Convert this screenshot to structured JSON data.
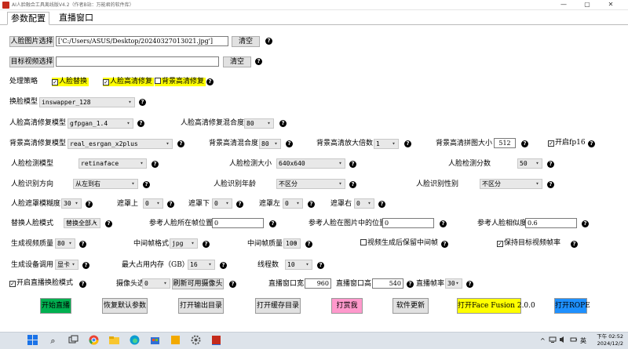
{
  "window": {
    "title": "AI人脸融合工具离线版V4.2（作者B站：万能君的软件库）",
    "minimize_glyph": "—",
    "maximize_glyph": "▢",
    "close_glyph": "✕"
  },
  "tabs": [
    "参数配置",
    "直播窗口"
  ],
  "help_glyph": "?",
  "dropdown_arrow": "▾",
  "check_glyph": "✓",
  "face_image": {
    "button": "人脸图片选择",
    "value": "['C:/Users/ASUS/Desktop/20240327013021.jpg']",
    "clear": "清空"
  },
  "target_video": {
    "button": "目标视频选择",
    "value": "",
    "clear": "清空"
  },
  "strategy": {
    "label": "处理策略",
    "options": [
      {
        "label": "人脸替换",
        "checked": true,
        "highlight": "#ffff00"
      },
      {
        "label": "人脸高清修复",
        "checked": true,
        "highlight": "#ffff00"
      },
      {
        "label": "背景高清修复",
        "checked": false,
        "highlight": "#ffff00"
      }
    ]
  },
  "swap_model": {
    "label": "换脸模型",
    "value": "inswapper_128"
  },
  "face_enhance": {
    "model_label": "人脸高清修复模型",
    "model_value": "gfpgan_1.4",
    "blend_label": "人脸高清修复混合度",
    "blend_value": "80"
  },
  "bg_enhance": {
    "model_label": "背景高清修复模型",
    "model_value": "real_esrgan_x2plus",
    "blend_label": "背景高清混合度",
    "blend_value": "80",
    "scale_label": "背景高清放大倍数",
    "scale_value": "1",
    "tile_label": "背景高清拼图大小",
    "tile_value": "512",
    "fp16_label": "开启fp16",
    "fp16_checked": true
  },
  "detect": {
    "model_label": "人脸检测模型",
    "model_value": "retinaface",
    "size_label": "人脸检测大小",
    "size_value": "640x640",
    "score_label": "人脸检测分数",
    "score_value": "50"
  },
  "recognize": {
    "direction_label": "人脸识别方向",
    "direction_value": "从左到右",
    "age_label": "人脸识别年龄",
    "age_value": "不区分",
    "gender_label": "人脸识别性别",
    "gender_value": "不区分"
  },
  "mask": {
    "blur_label": "人脸遮罩模糊度",
    "blur_value": "30",
    "top_label": "遮罩上",
    "top_value": "0",
    "bottom_label": "遮罩下",
    "bottom_value": "0",
    "left_label": "遮罩左",
    "left_value": "0",
    "right_label": "遮罩右",
    "right_value": "0"
  },
  "reference": {
    "mode_label": "替换人脸模式",
    "mode_value": "替换全部人",
    "frame_label": "参考人脸所在帧位置",
    "frame_value": "0",
    "pos_label": "参考人脸在图片中的位置",
    "pos_value": "0",
    "sim_label": "参考人脸相似度",
    "sim_value": "0.6"
  },
  "output": {
    "quality_label": "生成视频质量",
    "quality_value": "80",
    "frame_fmt_label": "中间帧格式",
    "frame_fmt_value": "jpg",
    "frame_q_label": "中间帧质量",
    "frame_q_value": "100",
    "keep_frames_label": "视频生成后保留中间帧",
    "keep_frames_checked": false,
    "keep_fps_label": "保持目标视频帧率",
    "keep_fps_checked": true
  },
  "device": {
    "device_label": "生成设备调用",
    "device_value": "显卡",
    "mem_label": "最大占用内存（GB）",
    "mem_value": "16",
    "threads_label": "线程数",
    "threads_value": "10"
  },
  "live": {
    "enable_label": "开启直播换脸模式",
    "enable_checked": true,
    "cam_label": "摄像头选择",
    "cam_value": "0",
    "refresh_label": "刷新可用摄像头",
    "width_label": "直播窗口宽",
    "width_value": "960",
    "height_label": "直播窗口高",
    "height_value": "540",
    "fps_label": "直播帧率",
    "fps_value": "30"
  },
  "actions": [
    {
      "label": "开始直播",
      "color": "#00b050",
      "text_color": "#000000"
    },
    {
      "label": "恢复默认参数",
      "color": "#e1e1e1",
      "text_color": "#000000"
    },
    {
      "label": "打开输出目录",
      "color": "#e1e1e1",
      "text_color": "#000000"
    },
    {
      "label": "打开缓存目录",
      "color": "#e1e1e1",
      "text_color": "#000000"
    },
    {
      "label": "打赏我",
      "color": "#ff99cc",
      "text_color": "#000000"
    },
    {
      "label": "软件更新",
      "color": "#e1e1e1",
      "text_color": "#000000"
    },
    {
      "label": "打开Face Fusion 2.0.0",
      "color": "#ffff00",
      "text_color": "#000000"
    },
    {
      "label": "打开ROPE",
      "color": "#1e90ff",
      "text_color": "#000000"
    }
  ],
  "taskbar": {
    "start_icon": "windows-logo-icon",
    "search_glyph": "⌕",
    "ime": "英",
    "chevron": "^",
    "time": "下午 02:52",
    "date": "2024/12/2"
  }
}
